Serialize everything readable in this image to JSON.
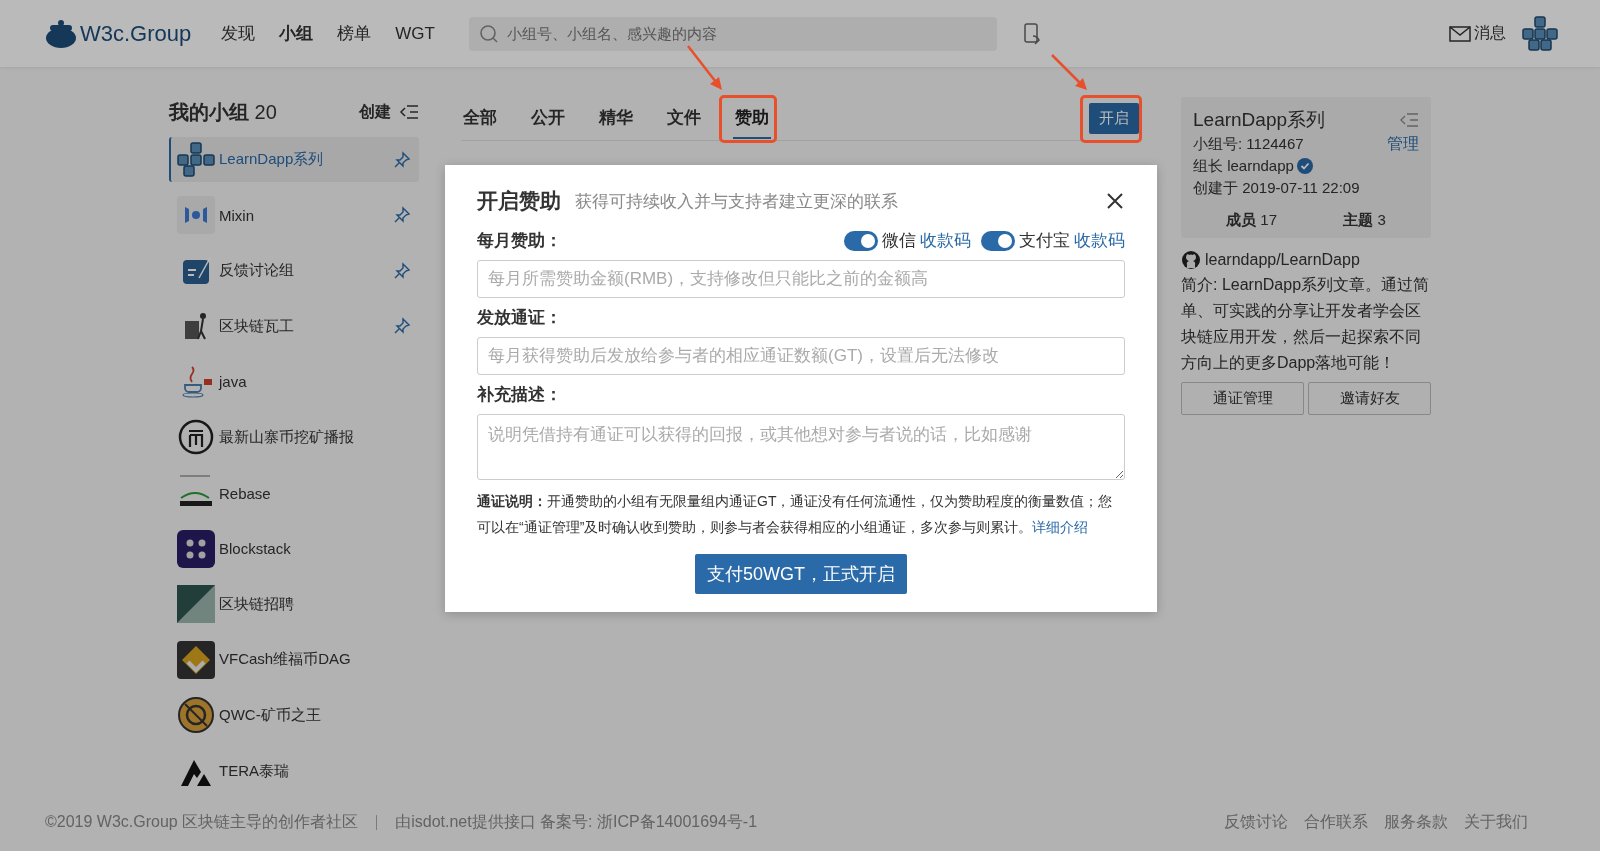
{
  "header": {
    "logo": "W3c.Group",
    "nav": [
      {
        "label": "发现",
        "selected": false
      },
      {
        "label": "小组",
        "selected": true
      },
      {
        "label": "榜单",
        "selected": false
      },
      {
        "label": "WGT",
        "selected": false
      }
    ],
    "search": {
      "placeholder": "小组号、小组名、感兴趣的内容"
    },
    "messages": "消息"
  },
  "sidebar": {
    "title": "我的小组",
    "count": "20",
    "create": "创建",
    "groups": [
      {
        "name": "LearnDapp系列",
        "kind": "cubes",
        "selected": true,
        "pinned": true
      },
      {
        "name": "Mixin",
        "kind": "mixin",
        "selected": false,
        "pinned": true
      },
      {
        "name": "反馈讨论组",
        "kind": "feedback",
        "selected": false,
        "pinned": true
      },
      {
        "name": "区块链瓦工",
        "kind": "worker",
        "selected": false,
        "pinned": true
      },
      {
        "name": "java",
        "kind": "java",
        "selected": false,
        "pinned": false
      },
      {
        "name": "最新山寨币挖矿播报",
        "kind": "coin",
        "selected": false,
        "pinned": false
      },
      {
        "name": "Rebase",
        "kind": "rebase",
        "selected": false,
        "pinned": false
      },
      {
        "name": "Blockstack",
        "kind": "blockstack",
        "selected": false,
        "pinned": false
      },
      {
        "name": "区块链招聘",
        "kind": "diagonal",
        "selected": false,
        "pinned": false
      },
      {
        "name": "VFCash维福币DAG",
        "kind": "vfcash",
        "selected": false,
        "pinned": false
      },
      {
        "name": "QWC-矿币之王",
        "kind": "qwc",
        "selected": false,
        "pinned": false
      },
      {
        "name": "TERA泰瑞",
        "kind": "tera",
        "selected": false,
        "pinned": false
      }
    ]
  },
  "tabs": [
    {
      "label": "全部",
      "selected": false
    },
    {
      "label": "公开",
      "selected": false
    },
    {
      "label": "精华",
      "selected": false
    },
    {
      "label": "文件",
      "selected": false
    },
    {
      "label": "赞助",
      "selected": true
    }
  ],
  "open_button": "开启",
  "modal": {
    "title": "开启赞助",
    "subtitle": "获得可持续收入并与支持者建立更深的联系",
    "toggles": [
      {
        "label": "微信",
        "link": "收款码",
        "on": true
      },
      {
        "label": "支付宝",
        "link": "收款码",
        "on": true
      }
    ],
    "fields": [
      {
        "label": "每月赞助：",
        "placeholder": "每月所需赞助金额(RMB)，支持修改但只能比之前的金额高",
        "kind": "input"
      },
      {
        "label": "发放通证：",
        "placeholder": "每月获得赞助后发放给参与者的相应通证数额(GT)，设置后无法修改",
        "kind": "input"
      },
      {
        "label": "补充描述：",
        "placeholder": "说明凭借持有通证可以获得的回报，或其他想对参与者说的话，比如感谢",
        "kind": "textarea"
      }
    ],
    "note": "**通证说明：**开通赞助的小组有无限量组内通证GT，通证没有任何流通性，仅为赞助程度的衡量数值；您可以在“通证管理”及时确认收到赞助，则参与者会获得相应的小组通证，多次参与则累计。",
    "note_link": "详细介绍",
    "submit": "支付50WGT，正式开启"
  },
  "group_card": {
    "name": "LearnDapp系列",
    "group_id": "小组号: 1124467",
    "manage": "管理",
    "owner": "组长 learndapp",
    "verified": true,
    "created": "创建于 2019-07-11 22:09",
    "stats": [
      {
        "label": "成员",
        "value": "17"
      },
      {
        "label": "主题",
        "value": "3"
      }
    ],
    "github": "learndapp/LearnDapp",
    "intro": "简介: LearnDapp系列文章。通过简单、可实践的分享让开发者学会区块链应用开发，然后一起探索不同方向上的更多Dapp落地可能！",
    "buttons": [
      "通证管理",
      "邀请好友"
    ]
  },
  "footer": {
    "left": [
      "©2019 W3c.Group 区块链主导的创作者社区",
      "由isdot.net提供接口 备案号: 浙ICP备14001694号-1"
    ],
    "links": [
      "反馈讨论",
      "合作联系",
      "服务条款",
      "关于我们"
    ]
  }
}
